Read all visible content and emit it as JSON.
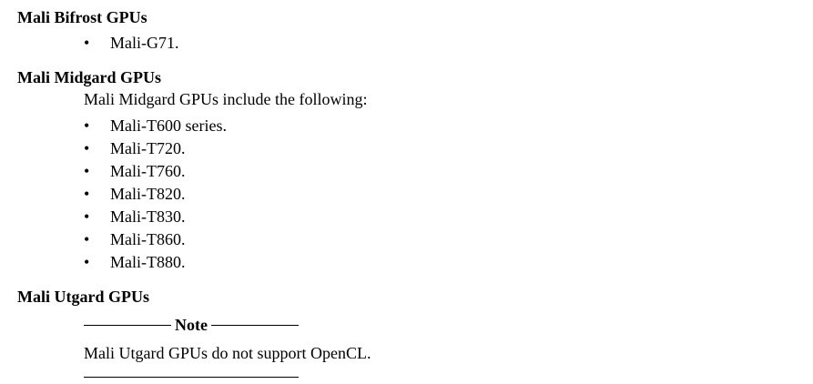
{
  "sections": {
    "bifrost": {
      "heading": "Mali Bifrost GPUs",
      "items": [
        "Mali-G71."
      ]
    },
    "midgard": {
      "heading": "Mali Midgard GPUs",
      "intro": "Mali Midgard GPUs include the following:",
      "items": [
        "Mali-T600 series.",
        "Mali-T720.",
        "Mali-T760.",
        "Mali-T820.",
        "Mali-T830.",
        "Mali-T860.",
        "Mali-T880."
      ]
    },
    "utgard": {
      "heading": "Mali Utgard GPUs",
      "note_label": "Note",
      "note_text": "Mali Utgard GPUs do not support OpenCL."
    }
  },
  "bullet_glyph": "•"
}
